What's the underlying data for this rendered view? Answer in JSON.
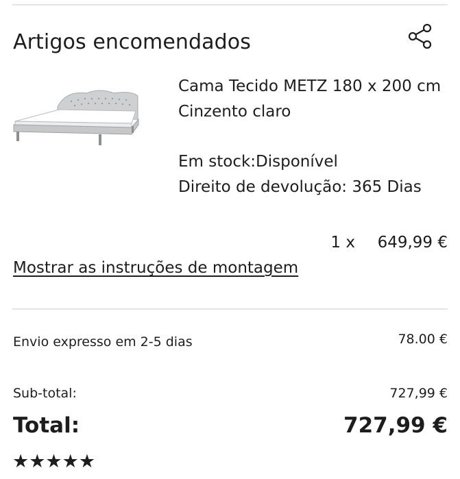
{
  "section": {
    "heading": "Artigos encomendados",
    "share_icon": "share-icon"
  },
  "product": {
    "image_icon": "bed-image",
    "name": "Cama Tecido METZ 180 x 200 cm Cinzento claro",
    "stock": "Em stock:Disponível",
    "return_right": "Direito de devolução: 365 Dias",
    "quantity": "1 x",
    "price": "649,99 €"
  },
  "assembly_link": "Mostrar as instruções de montagem",
  "summary": {
    "shipping_label": "Envio expresso em 2-5 dias",
    "shipping_value": "78.00 €",
    "subtotal_label": "Sub-total:",
    "subtotal_value": "727,99 €",
    "total_label": "Total:",
    "total_value": "727,99 €"
  },
  "rating": {
    "stars": "★★★★★",
    "value": 5,
    "max": 5
  }
}
